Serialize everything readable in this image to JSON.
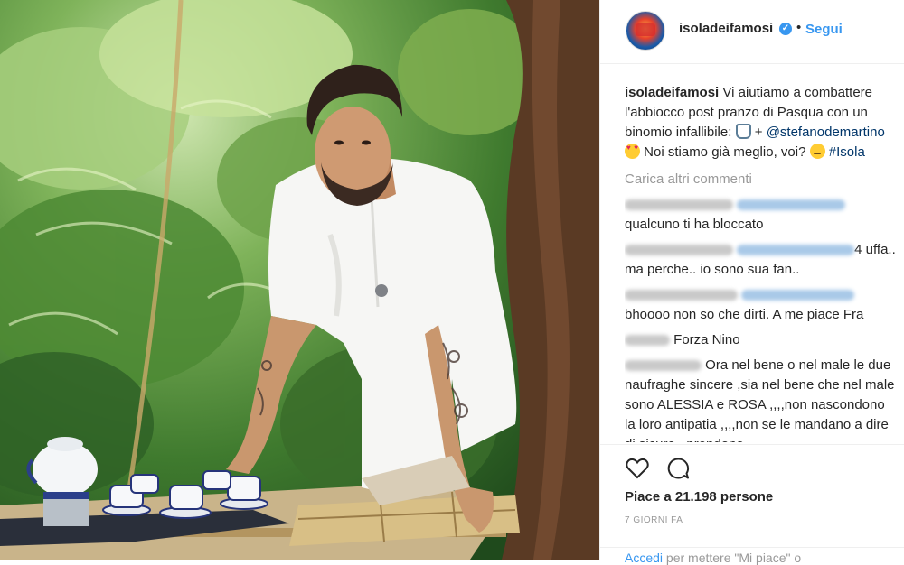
{
  "post": {
    "account": "isoladeifamosi",
    "follow_label": "Segui",
    "dot": "•",
    "verified_glyph": "✓",
    "caption": {
      "user": "isoladeifamosi",
      "text_1": "Vi aiutiamo a combattere l'abbiocco post pranzo di Pasqua con un binomio infallibile:",
      "plus": "+",
      "mention": "@stefanodemartino",
      "text_2": "Noi stiamo già meglio, voi?",
      "hashtag": "#Isola"
    },
    "load_more": "Carica altri commenti",
    "comments": [
      {
        "text": "qualcuno ti ha bloccato"
      },
      {
        "text_suffix": "4 uffa..",
        "text": "ma perche.. io sono sua fan.."
      },
      {
        "text": "bhoooo non so che dirti. A me piace Fra"
      },
      {
        "text": "Forza Nino"
      },
      {
        "text": "Ora nel bene o nel male le due naufraghe sincere ,sia nel bene che nel male sono ALESSIA e ROSA ,,,,non nascondono la loro antipatia ,,,,non se le mandano a dire di sicuro , prendono"
      }
    ],
    "likes": "Piace a 21.198 persone",
    "time_ago": "7 GIORNI FA",
    "login": {
      "link": "Accedi",
      "rest": "per mettere \"Mi piace\" o"
    }
  },
  "icons": {
    "like": "heart-icon",
    "comment": "comment-bubble-icon",
    "verified": "verified-badge-icon"
  },
  "colors": {
    "link_blue": "#3897f0",
    "tag_blue": "#003569",
    "muted": "#999999"
  }
}
